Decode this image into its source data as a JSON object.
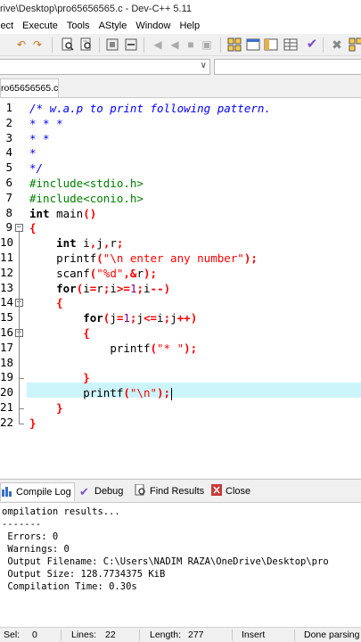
{
  "window": {
    "title": "rive\\Desktop\\pro65656565.c - Dev-C++ 5.11"
  },
  "menu": [
    "ject",
    "Execute",
    "Tools",
    "AStyle",
    "Window",
    "Help"
  ],
  "toolbar": {
    "icons": [
      "undo-icon",
      "redo-icon",
      "find-icon",
      "replace-icon",
      "print-icon",
      "compile-icon",
      "run-icon",
      "check-icon",
      "close-icon"
    ]
  },
  "file_tab": {
    "label": "ro65656565.c"
  },
  "editor": {
    "line_numbers": [
      "1",
      "2",
      "3",
      "4",
      "5",
      "6",
      "7",
      "8",
      "9",
      "10",
      "11",
      "12",
      "13",
      "14",
      "15",
      "16",
      "17",
      "18",
      "19",
      "20",
      "21",
      "22"
    ],
    "lines": [
      "/* w.a.p to print following pattern.",
      "* * *",
      "* *",
      "*",
      "*/",
      "#include<stdio.h>",
      "#include<conio.h>",
      "int main()",
      "{",
      "    int i,j,r;",
      "    printf(\"\\n enter any number\");",
      "    scanf(\"%d\",&r);",
      "    for(i=r;i>=1;i--)",
      "    {",
      "        for(j=1;j<=i;j++)",
      "        {",
      "            printf(\"* \");",
      "",
      "        }",
      "        printf(\"\\n\");",
      "    }",
      "}"
    ]
  },
  "log_tabs": [
    {
      "label": "Compile Log",
      "icon": "chart-icon"
    },
    {
      "label": "Debug",
      "icon": "check-icon"
    },
    {
      "label": "Find Results",
      "icon": "find-icon"
    },
    {
      "label": "Close",
      "icon": "close-icon"
    }
  ],
  "log": [
    "ompilation results...",
    "-------",
    " Errors: 0",
    " Warnings: 0",
    " Output Filename: C:\\Users\\NADIM RAZA\\OneDrive\\Desktop\\pro",
    " Output Size: 128.7734375 KiB",
    " Compilation Time: 0.30s"
  ],
  "status": {
    "sel_label": "Sel:",
    "sel_value": "0",
    "lines_label": "Lines:",
    "lines_value": "22",
    "length_label": "Length:",
    "length_value": "277",
    "mode": "Insert",
    "message": "Done parsing"
  },
  "colors": {
    "comment": "#0000ff",
    "preprocessor": "#008000",
    "string": "#ff0000",
    "number": "#800080",
    "current_line": "#ccf5fb"
  }
}
